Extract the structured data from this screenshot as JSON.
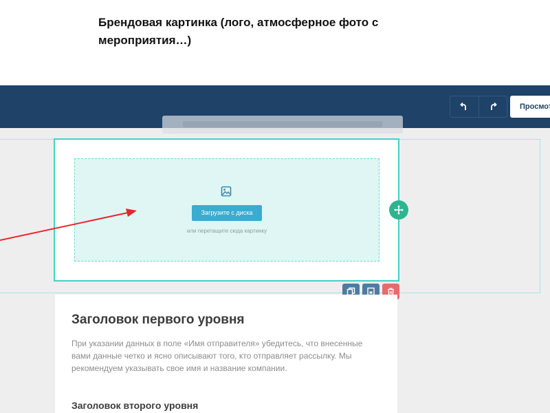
{
  "caption": "Брендовая картинка (лого, атмосферное фото с мероприятия…)",
  "toolbar": {
    "undo_icon": "undo-icon",
    "redo_icon": "redo-icon",
    "preview_label": "Просмотр"
  },
  "image_block": {
    "icon": "image-icon",
    "upload_label": "Загрузите с диска",
    "drop_hint": "или перетащите сюда картинку"
  },
  "block_tools": [
    "copy-icon",
    "save-icon",
    "trash-icon"
  ],
  "content": {
    "heading1": "Заголовок первого уровня",
    "paragraph": "При указании данных в поле «Имя отправителя» убедитесь, что внесенные вами данные четко и ясно описывают того, кто отправляет рассылку. Мы рекомендуем указывать свое имя и название компании.",
    "heading2": "Заголовок второго уровня"
  },
  "colors": {
    "topbar": "#1e4268",
    "accent_teal": "#3fd3c6",
    "upload_button": "#3aaccf",
    "move_handle": "#2db590",
    "delete": "#e56c6c",
    "annotation_arrow": "#e8262b"
  }
}
